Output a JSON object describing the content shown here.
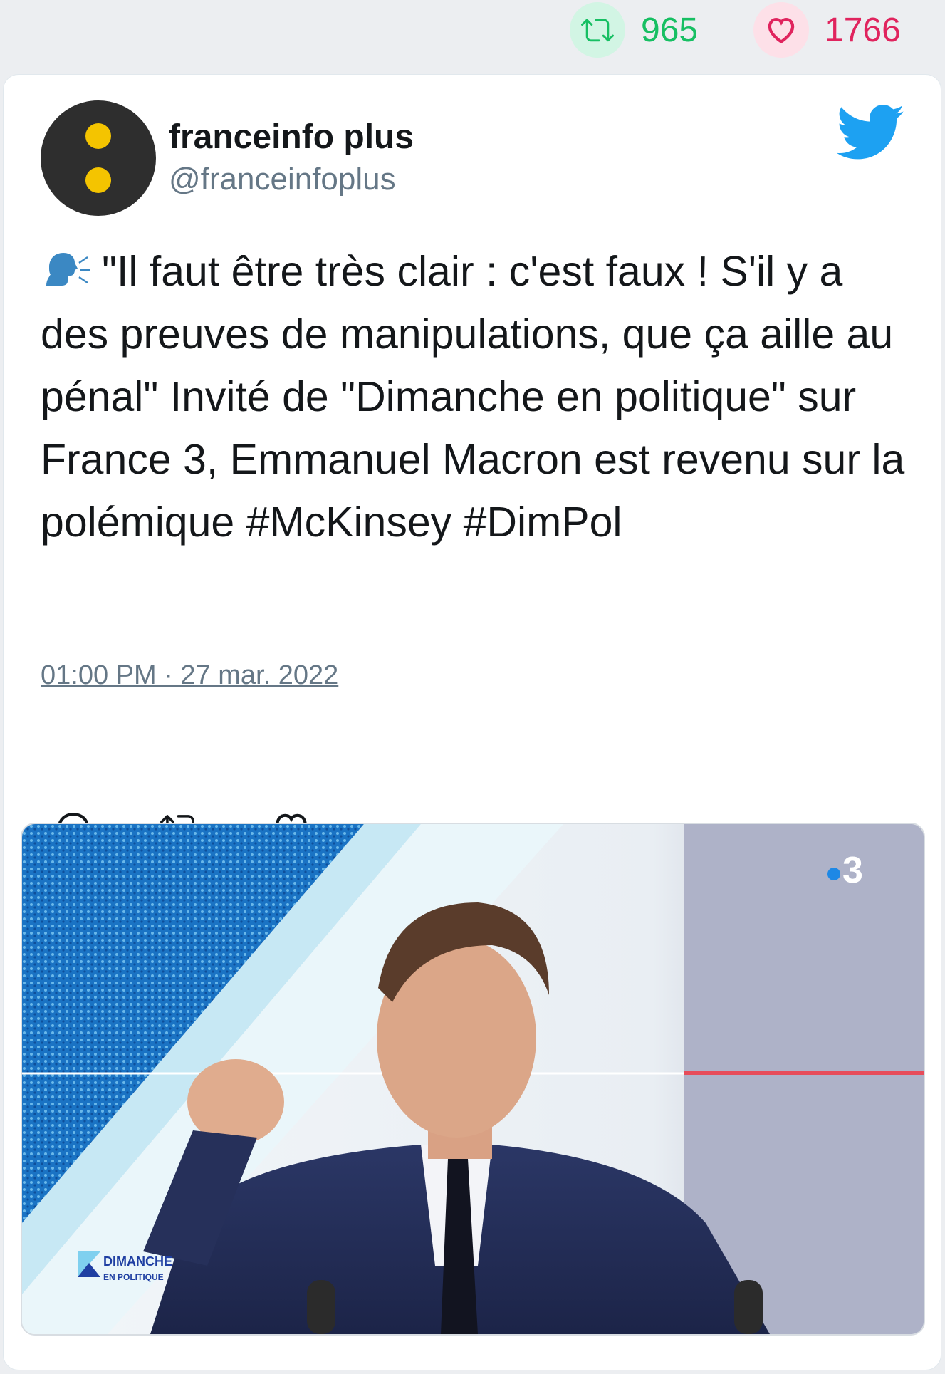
{
  "stats": {
    "retweets": "965",
    "likes": "1766"
  },
  "tweet": {
    "author_name": "franceinfo plus",
    "author_handle": "@franceinfoplus",
    "text": "\"Il faut être très clair : c'est faux ! S'il y a des preuves de manipulations, que ça aille au pénal\" Invité de \"Dimanche en politique\" sur France 3, Emmanuel Macron est revenu sur la polémique #McKinsey #DimPol",
    "timestamp": "01:00 PM · 27 mar. 2022"
  },
  "media": {
    "channel_logo": "3",
    "show_logo_line1": "DIMANCHE",
    "show_logo_line2": "EN POLITIQUE"
  },
  "icons": {
    "retweet": "retweet-icon",
    "like": "heart-icon",
    "reply": "reply-icon",
    "brand": "twitter-bird-icon",
    "speaking": "speaking-head-icon"
  },
  "colors": {
    "retweet_green": "#17bf63",
    "like_red": "#e0245e",
    "twitter_blue": "#1da1f2",
    "avatar_dot_yellow": "#f4c400",
    "muted_gray": "#657786"
  }
}
